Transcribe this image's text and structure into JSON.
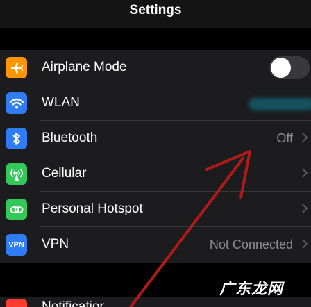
{
  "header": {
    "title": "Settings"
  },
  "rows": [
    {
      "label": "Airplane Mode",
      "icon": "airplane-icon",
      "icon_color": "#ff9500",
      "toggle_on": false
    },
    {
      "label": "WLAN",
      "icon": "wifi-icon",
      "icon_color": "#2f7cf6"
    },
    {
      "label": "Bluetooth",
      "icon": "bluetooth-icon",
      "icon_color": "#2f7cf6",
      "value": "Off"
    },
    {
      "label": "Cellular",
      "icon": "cellular-icon",
      "icon_color": "#34c759"
    },
    {
      "label": "Personal Hotspot",
      "icon": "hotspot-icon",
      "icon_color": "#34c759"
    },
    {
      "label": "VPN",
      "icon": "vpn-icon",
      "icon_color": "#2f7cf6",
      "value": "Not Connected",
      "icon_text": "VPN"
    }
  ],
  "next_row": {
    "label": "Notifications",
    "icon": "notifications-icon",
    "icon_color": "#ff3b30"
  },
  "annotation": {
    "arrow_color": "#b01a1a"
  },
  "watermark": {
    "text": "广东龙网"
  }
}
